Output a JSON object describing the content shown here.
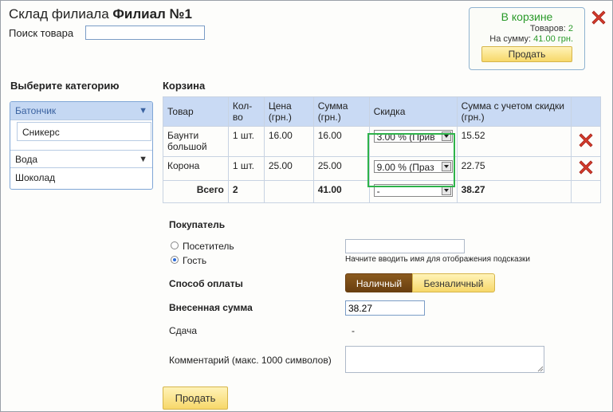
{
  "header": {
    "title_prefix": "Склад филиала",
    "title_branch": "Филиал №1",
    "search_label": "Поиск товара",
    "search_value": ""
  },
  "cart_summary": {
    "title": "В корзине",
    "items_label": "Товаров:",
    "items_count": "2",
    "sum_label": "На сумму:",
    "sum_value": "41.00 грн.",
    "sell_label": "Продать"
  },
  "categories": {
    "heading": "Выберите категорию",
    "items": [
      {
        "label": "Батончик",
        "expanded": true
      },
      {
        "label": "Вода",
        "expanded": false
      },
      {
        "label": "Шоколад",
        "expanded": false
      }
    ],
    "sub_items": [
      "Сникерс"
    ]
  },
  "basket": {
    "heading": "Корзина",
    "columns": [
      "Товар",
      "Кол-во",
      "Цена (грн.)",
      "Сумма (грн.)",
      "Скидка",
      "Сумма с учетом скидки (грн.)"
    ],
    "rows": [
      {
        "product": "Баунти большой",
        "qty": "1 шт.",
        "price": "16.00",
        "sum": "16.00",
        "discount": "3.00 % (Прив",
        "total": "15.52"
      },
      {
        "product": "Корона",
        "qty": "1 шт.",
        "price": "25.00",
        "sum": "25.00",
        "discount": "9.00 % (Праз",
        "total": "22.75"
      }
    ],
    "totals": {
      "label": "Всего",
      "qty": "2",
      "sum": "41.00",
      "discount": "-",
      "total": "38.27"
    }
  },
  "buyer": {
    "heading": "Покупатель",
    "options": [
      {
        "label": "Посетитель",
        "checked": false
      },
      {
        "label": "Гость",
        "checked": true
      }
    ],
    "name_value": "",
    "hint": "Начните вводить имя для отображения подсказки"
  },
  "payment": {
    "label": "Способ оплаты",
    "cash": "Наличный",
    "card": "Безналичный",
    "selected": "cash"
  },
  "deposit": {
    "label": "Внесенная сумма",
    "value": "38.27"
  },
  "change": {
    "label": "Сдача",
    "value": "-"
  },
  "comment": {
    "label": "Комментарий (макс. 1000 символов)",
    "value": ""
  },
  "sell_button": "Продать",
  "colors": {
    "accent_green": "#2a9a2a",
    "highlight_border": "#2eb34a",
    "delete_red": "#d33b2c",
    "header_blue": "#c9daf4"
  }
}
